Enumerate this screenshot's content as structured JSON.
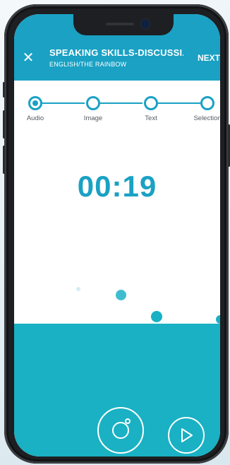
{
  "header": {
    "close_icon": "close-icon",
    "title": "SPEAKING SKILLS-DISCUSSI...",
    "subtitle": "ENGLISH/THE RAINBOW",
    "next_label": "NEXT"
  },
  "steps": [
    {
      "label": "Audio",
      "active": true
    },
    {
      "label": "Image",
      "active": false
    },
    {
      "label": "Text",
      "active": false
    },
    {
      "label": "Selection",
      "active": false
    }
  ],
  "timer": "00:19",
  "controls": {
    "record_icon": "record-icon",
    "play_icon": "play-icon"
  },
  "colors": {
    "accent": "#1aa1c4",
    "water": "#19b1c3",
    "text_muted": "#555b60"
  }
}
